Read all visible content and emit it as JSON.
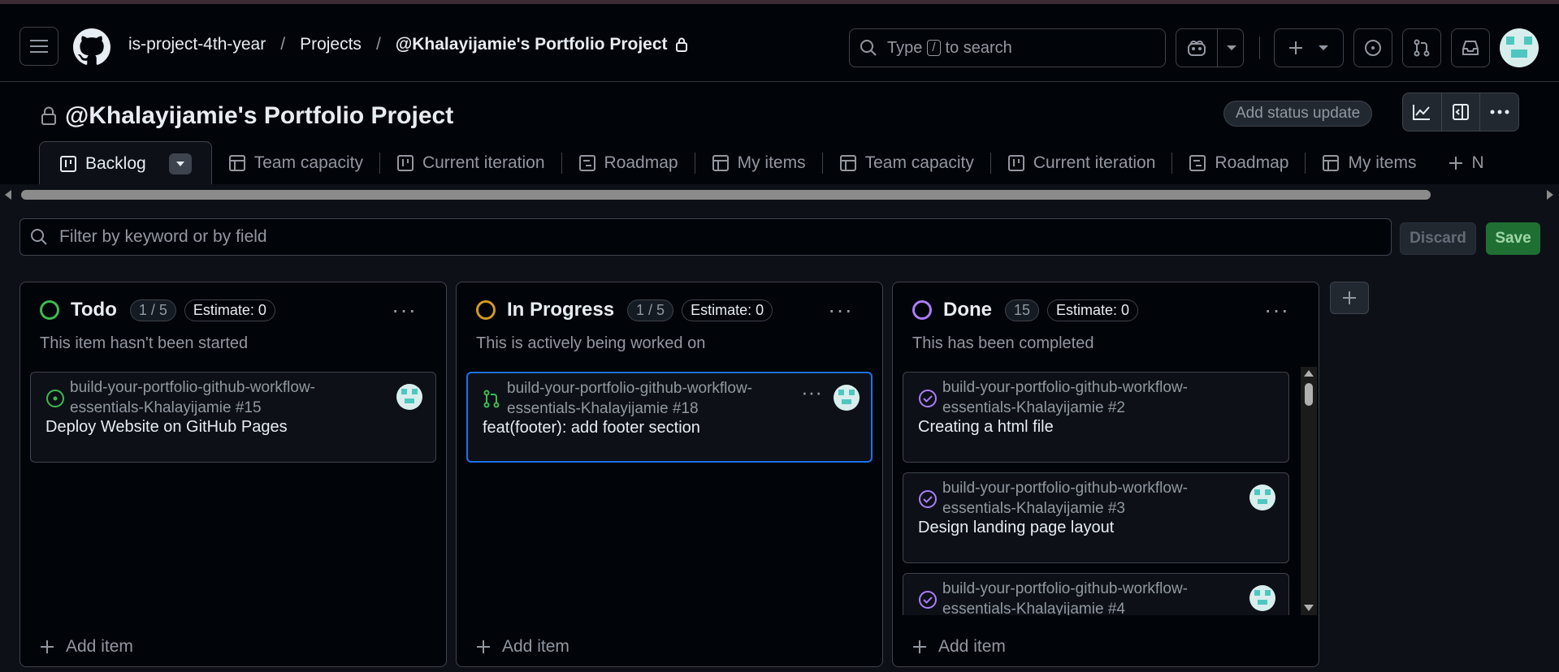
{
  "header": {
    "breadcrumb": [
      "is-project-4th-year",
      "Projects",
      "@Khalayijamie's Portfolio Project"
    ],
    "search": {
      "before": "Type",
      "key": "/",
      "after": "to search"
    }
  },
  "project": {
    "title": "@Khalayijamie's Portfolio Project",
    "status_button": "Add status update",
    "tabs": [
      {
        "label": "Backlog",
        "icon": "board-icon"
      },
      {
        "label": "Team capacity",
        "icon": "table-icon"
      },
      {
        "label": "Current iteration",
        "icon": "board-icon"
      },
      {
        "label": "Roadmap",
        "icon": "roadmap-icon"
      },
      {
        "label": "My items",
        "icon": "table-icon"
      },
      {
        "label": "Team capacity",
        "icon": "table-icon"
      },
      {
        "label": "Current iteration",
        "icon": "board-icon"
      },
      {
        "label": "Roadmap",
        "icon": "roadmap-icon"
      },
      {
        "label": "My items",
        "icon": "table-icon"
      }
    ],
    "new_view_partial": "N"
  },
  "toolbar": {
    "filter_placeholder": "Filter by keyword or by field",
    "discard": "Discard",
    "save": "Save"
  },
  "columns": [
    {
      "name": "Todo",
      "count": "1 / 5",
      "estimate": "Estimate: 0",
      "description": "This item hasn't been started",
      "color": "#3fb950",
      "add_item": "Add item",
      "cards": [
        {
          "repo": "build-your-portfolio-github-workflow-essentials-Khalayijamie #15",
          "title": "Deploy Website on GitHub Pages",
          "type": "open-issue"
        }
      ]
    },
    {
      "name": "In Progress",
      "count": "1 / 5",
      "estimate": "Estimate: 0",
      "description": "This is actively being worked on",
      "color": "#d29922",
      "add_item": "Add item",
      "cards": [
        {
          "repo": "build-your-portfolio-github-workflow-essentials-Khalayijamie #18",
          "title": "feat(footer): add footer section",
          "type": "pull-request"
        }
      ]
    },
    {
      "name": "Done",
      "count": "15",
      "estimate": "Estimate: 0",
      "description": "This has been completed",
      "color": "#ab7df8",
      "add_item": "Add item",
      "cards": [
        {
          "repo": "build-your-portfolio-github-workflow-essentials-Khalayijamie #2",
          "title": "Creating a html file",
          "type": "closed-issue"
        },
        {
          "repo": "build-your-portfolio-github-workflow-essentials-Khalayijamie #3",
          "title": "Design landing page layout",
          "type": "closed-issue"
        },
        {
          "repo": "build-your-portfolio-github-workflow-essentials-Khalayijamie #4",
          "title": "",
          "type": "closed-issue"
        }
      ]
    }
  ],
  "colors": {
    "accent": "#1f6feb",
    "save_green": "#1f6f33"
  }
}
